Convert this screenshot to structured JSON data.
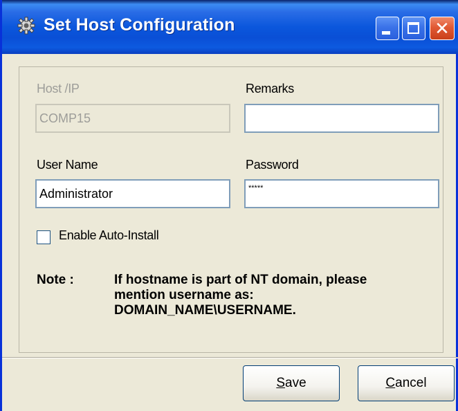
{
  "window": {
    "title": "Set Host Configuration",
    "icon": "gear-icon",
    "controls": {
      "minimize": "minimize-icon",
      "maximize": "maximize-icon",
      "close": "close-icon",
      "close_glyph": "✕"
    }
  },
  "form": {
    "host": {
      "label": "Host /IP",
      "value": "COMP15",
      "disabled": true
    },
    "remarks": {
      "label": "Remarks",
      "value": ""
    },
    "username": {
      "label": "User Name",
      "value": "Administrator"
    },
    "password": {
      "label": "Password",
      "value": "*****"
    },
    "auto_install": {
      "label": "Enable Auto-Install",
      "checked": false
    }
  },
  "note": {
    "label": "Note :",
    "lines": [
      "If hostname is part of NT domain, please",
      "mention username as:",
      "DOMAIN_NAME\\USERNAME."
    ]
  },
  "buttons": {
    "save": {
      "mnemonic": "S",
      "rest": "ave"
    },
    "cancel": {
      "mnemonic": "C",
      "rest": "ancel"
    }
  },
  "colors": {
    "titlebar": "#0a4fd6",
    "dialog_bg": "#ece9d8",
    "close_button": "#e15a34",
    "field_border": "#7f9db9",
    "disabled_text": "#9d9d99"
  }
}
